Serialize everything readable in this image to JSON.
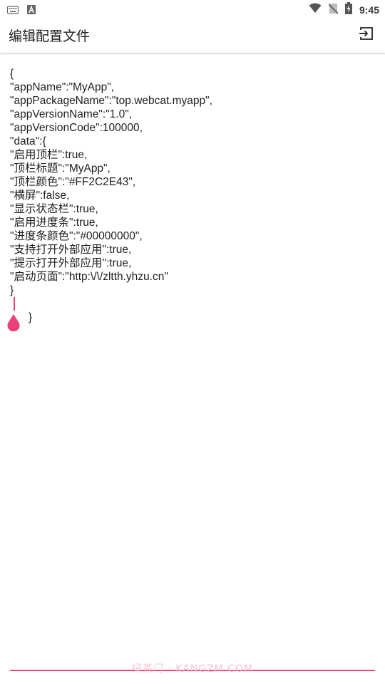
{
  "status_bar": {
    "time": "9:45",
    "left_icons": [
      "keyboard-icon",
      "font-a-icon"
    ],
    "right_icons": [
      "wifi-icon",
      "no-sim-icon",
      "battery-charging-icon"
    ]
  },
  "app_bar": {
    "title": "编辑配置文件",
    "action_icon": "exit-to-app-icon"
  },
  "editor": {
    "lines": [
      "{",
      "\"appName\":\"MyApp\",",
      "\"appPackageName\":\"top.webcat.myapp\",",
      "\"appVersionName\":\"1.0\",",
      "\"appVersionCode\":100000,",
      "\"data\":{",
      "\"启用顶栏\":true,",
      "\"顶栏标题\":\"MyApp\",",
      "\"顶栏颜色\":\"#FF2C2E43\",",
      "\"横屏\":false,",
      "\"显示状态栏\":true,",
      "\"启用进度条\":true,",
      "\"进度条颜色\":\"#00000000\",",
      "\"支持打开外部应用\":true,",
      "\"提示打开外部应用\":true,",
      "\"启动页面\":\"http:\\/\\/zltth.yhzu.cn\"",
      "}",
      "}"
    ],
    "accent_color": "#ec407a"
  },
  "watermark": "绿茶门 · KANGZM.COM"
}
